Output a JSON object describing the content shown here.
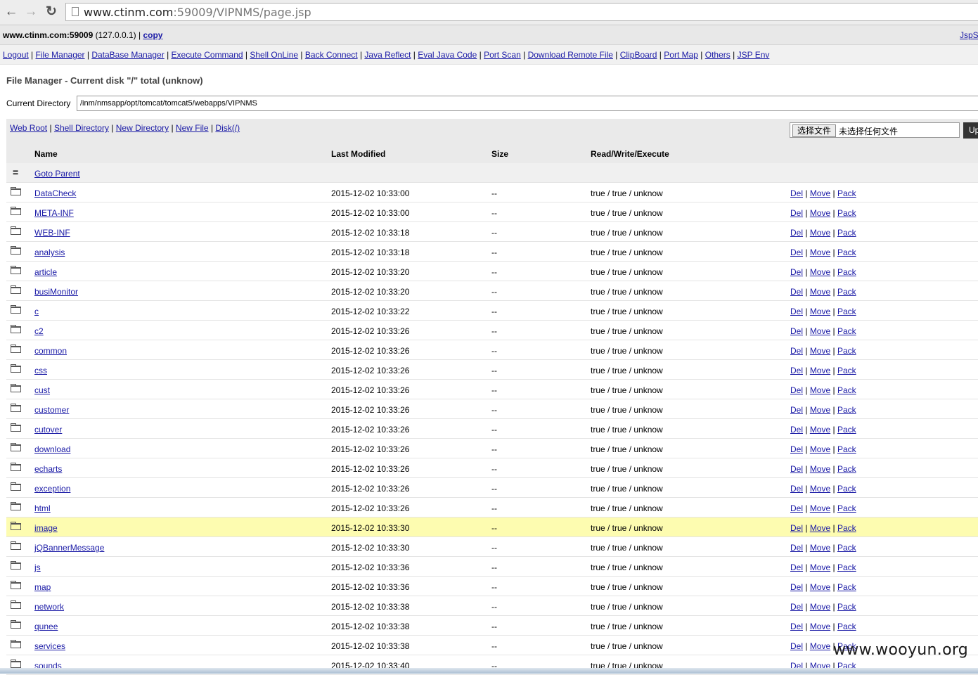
{
  "browser": {
    "url_host": "www.ctinm.com",
    "url_rest": ":59009/VIPNMS/page.jsp",
    "back_glyph": "←",
    "forward_glyph": "→",
    "reload_glyph": "↻"
  },
  "header": {
    "host": "www.ctinm.com:59009",
    "ip": " (127.0.0.1) | ",
    "copy": "copy",
    "right_link": "JspS"
  },
  "menu": [
    "Logout",
    "File Manager",
    "DataBase Manager",
    "Execute Command",
    "Shell OnLine",
    "Back Connect",
    "Java Reflect",
    "Eval Java Code",
    "Port Scan",
    "Download Remote File",
    "ClipBoard",
    "Port Map",
    "Others",
    "JSP Env"
  ],
  "title": "File Manager - Current disk \"/\" total (unknow)",
  "current_dir": {
    "label": "Current Directory",
    "value": "/inm/nmsapp/opt/tomcat/tomcat5/webapps/VIPNMS"
  },
  "tools": {
    "links": [
      "Web Root",
      "Shell Directory",
      "New Directory",
      "New File",
      "Disk(/)"
    ],
    "choose_file": "选择文件",
    "no_file": "未选择任何文件",
    "upload": "Up"
  },
  "table": {
    "headers": {
      "name": "Name",
      "modified": "Last Modified",
      "size": "Size",
      "rwx": "Read/Write/Execute"
    },
    "parent": {
      "symbol": "=",
      "label": "Goto Parent"
    },
    "actions": [
      "Del",
      "Move",
      "Pack"
    ],
    "rows": [
      {
        "name": "DataCheck",
        "modified": "2015-12-02 10:33:00",
        "size": "--",
        "rwx": "true / true / unknow"
      },
      {
        "name": "META-INF",
        "modified": "2015-12-02 10:33:00",
        "size": "--",
        "rwx": "true / true / unknow"
      },
      {
        "name": "WEB-INF",
        "modified": "2015-12-02 10:33:18",
        "size": "--",
        "rwx": "true / true / unknow"
      },
      {
        "name": "analysis",
        "modified": "2015-12-02 10:33:18",
        "size": "--",
        "rwx": "true / true / unknow"
      },
      {
        "name": "article",
        "modified": "2015-12-02 10:33:20",
        "size": "--",
        "rwx": "true / true / unknow"
      },
      {
        "name": "busiMonitor",
        "modified": "2015-12-02 10:33:20",
        "size": "--",
        "rwx": "true / true / unknow"
      },
      {
        "name": "c",
        "modified": "2015-12-02 10:33:22",
        "size": "--",
        "rwx": "true / true / unknow"
      },
      {
        "name": "c2",
        "modified": "2015-12-02 10:33:26",
        "size": "--",
        "rwx": "true / true / unknow"
      },
      {
        "name": "common",
        "modified": "2015-12-02 10:33:26",
        "size": "--",
        "rwx": "true / true / unknow"
      },
      {
        "name": "css",
        "modified": "2015-12-02 10:33:26",
        "size": "--",
        "rwx": "true / true / unknow"
      },
      {
        "name": "cust",
        "modified": "2015-12-02 10:33:26",
        "size": "--",
        "rwx": "true / true / unknow"
      },
      {
        "name": "customer",
        "modified": "2015-12-02 10:33:26",
        "size": "--",
        "rwx": "true / true / unknow"
      },
      {
        "name": "cutover",
        "modified": "2015-12-02 10:33:26",
        "size": "--",
        "rwx": "true / true / unknow"
      },
      {
        "name": "download",
        "modified": "2015-12-02 10:33:26",
        "size": "--",
        "rwx": "true / true / unknow"
      },
      {
        "name": "echarts",
        "modified": "2015-12-02 10:33:26",
        "size": "--",
        "rwx": "true / true / unknow"
      },
      {
        "name": "exception",
        "modified": "2015-12-02 10:33:26",
        "size": "--",
        "rwx": "true / true / unknow"
      },
      {
        "name": "html",
        "modified": "2015-12-02 10:33:26",
        "size": "--",
        "rwx": "true / true / unknow"
      },
      {
        "name": "image",
        "modified": "2015-12-02 10:33:30",
        "size": "--",
        "rwx": "true / true / unknow",
        "highlight": true
      },
      {
        "name": "jQBannerMessage",
        "modified": "2015-12-02 10:33:30",
        "size": "--",
        "rwx": "true / true / unknow"
      },
      {
        "name": "js",
        "modified": "2015-12-02 10:33:36",
        "size": "--",
        "rwx": "true / true / unknow"
      },
      {
        "name": "map",
        "modified": "2015-12-02 10:33:36",
        "size": "--",
        "rwx": "true / true / unknow"
      },
      {
        "name": "network",
        "modified": "2015-12-02 10:33:38",
        "size": "--",
        "rwx": "true / true / unknow"
      },
      {
        "name": "qunee",
        "modified": "2015-12-02 10:33:38",
        "size": "--",
        "rwx": "true / true / unknow"
      },
      {
        "name": "services",
        "modified": "2015-12-02 10:33:38",
        "size": "--",
        "rwx": "true / true / unknow"
      },
      {
        "name": "sounds",
        "modified": "2015-12-02 10:33:40",
        "size": "--",
        "rwx": "true / true / unknow"
      }
    ]
  },
  "watermark": "www.wooyun.org",
  "colors": {
    "link": "#1a1aa6",
    "highlight_row": "#fdfcb0"
  }
}
